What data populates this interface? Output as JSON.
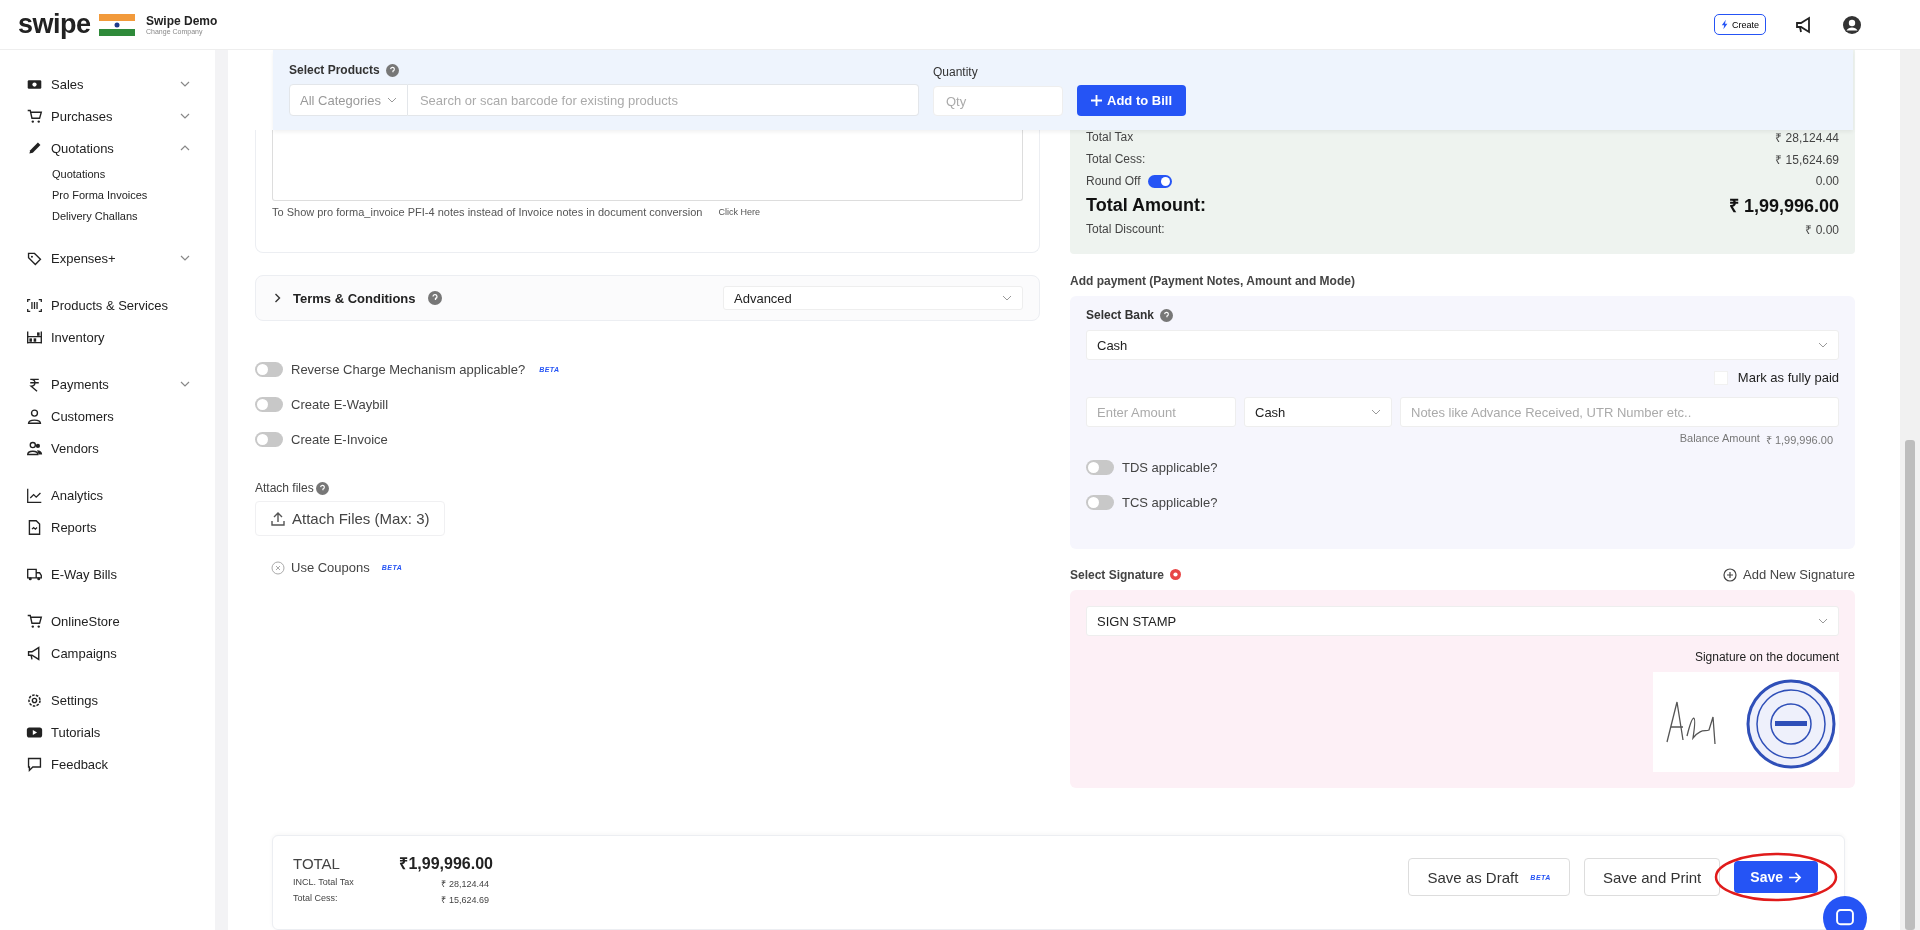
{
  "header": {
    "logo": "swipe",
    "company": "Swipe Demo",
    "change_company": "Change Company",
    "create_button": "Create"
  },
  "sidebar": {
    "groups": [
      [
        {
          "label": "Sales",
          "expanded": false
        },
        {
          "label": "Purchases",
          "expanded": false
        },
        {
          "label": "Quotations",
          "expanded": true,
          "children": [
            {
              "label": "Quotations"
            },
            {
              "label": "Pro Forma Invoices"
            },
            {
              "label": "Delivery Challans"
            }
          ]
        }
      ],
      [
        {
          "label": "Expenses+",
          "expanded": false
        }
      ],
      [
        {
          "label": "Products & Services"
        },
        {
          "label": "Inventory"
        }
      ],
      [
        {
          "label": "Payments",
          "expanded": false
        },
        {
          "label": "Customers"
        },
        {
          "label": "Vendors"
        }
      ],
      [
        {
          "label": "Analytics"
        },
        {
          "label": "Reports"
        }
      ],
      [
        {
          "label": "E-Way Bills"
        }
      ],
      [
        {
          "label": "OnlineStore"
        },
        {
          "label": "Campaigns"
        }
      ],
      [
        {
          "label": "Settings"
        },
        {
          "label": "Tutorials"
        },
        {
          "label": "Feedback"
        }
      ]
    ]
  },
  "product_bar": {
    "label": "Select Products",
    "category": "All Categories",
    "search_placeholder": "Search or scan barcode for existing products",
    "quantity_label": "Quantity",
    "quantity_placeholder": "Qty",
    "add_button": "Add to Bill"
  },
  "notes": {
    "hint": "To Show pro forma_invoice PFI-4 notes instead of Invoice notes in document conversion",
    "link": "Click Here"
  },
  "terms": {
    "label": "Terms & Conditions",
    "expanded": false,
    "select": "Advanced"
  },
  "options": [
    {
      "label": "Reverse Charge Mechanism applicable?",
      "on": false,
      "badge": "BETA"
    },
    {
      "label": "Create E-Waybill",
      "on": false
    },
    {
      "label": "Create E-Invoice",
      "on": false
    }
  ],
  "attach": {
    "label": "Attach files",
    "button": "Attach Files (Max: 3)"
  },
  "coupons": {
    "label": "Use Coupons",
    "badge": "BETA"
  },
  "summary": [
    {
      "kind": "row",
      "label": "Total Tax",
      "value": "₹ 28,124.44"
    },
    {
      "kind": "row",
      "label": "Total Cess:",
      "value": "₹ 15,624.69"
    },
    {
      "kind": "toggle",
      "label": "Round Off",
      "on": true,
      "value": "0.00"
    },
    {
      "kind": "total",
      "label": "Total Amount:",
      "value": "₹ 1,99,996.00"
    },
    {
      "kind": "row",
      "label": "Total Discount:",
      "value": "₹ 0.00"
    }
  ],
  "payment": {
    "title": "Add payment (Payment Notes, Amount and Mode)",
    "bank_label": "Select Bank",
    "bank": "Cash",
    "mark_paid": {
      "label": "Mark as fully paid",
      "checked": false
    },
    "amount_placeholder": "Enter Amount",
    "mode": "Cash",
    "notes_placeholder": "Notes like Advance Received, UTR Number etc..",
    "balance_label": "Balance Amount",
    "balance": "₹ 1,99,996.00",
    "toggles": [
      {
        "label": "TDS applicable?",
        "on": false
      },
      {
        "label": "TCS applicable?",
        "on": false
      }
    ]
  },
  "signature": {
    "label": "Select Signature",
    "add_link": "Add New Signature",
    "select": "SIGN STAMP",
    "caption": "Signature on the document"
  },
  "footer": {
    "total_label": "TOTAL",
    "total": "₹1,99,996.00",
    "lines": [
      {
        "label": "INCL. Total Tax",
        "value": "₹ 28,124.44"
      },
      {
        "label": "Total Cess:",
        "value": "₹ 15,624.69"
      }
    ],
    "buttons": [
      {
        "kind": "outline",
        "label": "Save as Draft",
        "badge": "BETA"
      },
      {
        "kind": "outline",
        "label": "Save and Print"
      },
      {
        "kind": "primary",
        "label": "Save",
        "highlighted": true
      }
    ]
  }
}
